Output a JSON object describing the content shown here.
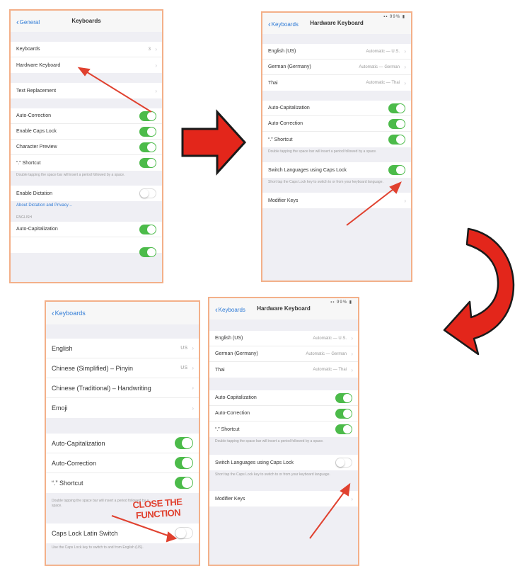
{
  "phones": {
    "p1": {
      "back": "General",
      "title": "Keyboards",
      "rows_a": [
        {
          "label": "Keyboards",
          "value": "3"
        },
        {
          "label": "Hardware Keyboard",
          "value": ""
        }
      ],
      "rows_b": [
        {
          "label": "Text Replacement",
          "value": ""
        }
      ],
      "toggles": [
        {
          "label": "Auto-Correction",
          "on": true
        },
        {
          "label": "Enable Caps Lock",
          "on": true
        },
        {
          "label": "Character Preview",
          "on": true
        },
        {
          "label": "“.” Shortcut",
          "on": true
        }
      ],
      "note_shortcut": "Double tapping the space bar will insert a period followed by a space.",
      "dictation": {
        "label": "Enable Dictation",
        "on": false
      },
      "dictation_link": "About Dictation and Privacy…",
      "section": "ENGLISH",
      "autocap": {
        "label": "Auto-Capitalization",
        "on": true
      }
    },
    "p2": {
      "status": "▪▪ 99% ▮",
      "back": "Keyboards",
      "title": "Hardware Keyboard",
      "langs": [
        {
          "label": "English (US)",
          "value": "Automatic — U.S."
        },
        {
          "label": "German (Germany)",
          "value": "Automatic — German"
        },
        {
          "label": "Thai",
          "value": "Automatic — Thai"
        }
      ],
      "toggles": [
        {
          "label": "Auto-Capitalization",
          "on": true
        },
        {
          "label": "Auto-Correction",
          "on": true
        },
        {
          "label": "“.” Shortcut",
          "on": true
        }
      ],
      "note_shortcut": "Double tapping the space bar will insert a period followed by a space.",
      "switch": {
        "label": "Switch Languages using Caps Lock",
        "on": true
      },
      "note_switch": "Short tap the Caps Lock key to switch to or from your keyboard language.",
      "modifier": "Modifier Keys"
    },
    "p3": {
      "status": "▪▪ 99% ▮",
      "back": "Keyboards",
      "title": "Hardware Keyboard",
      "langs": [
        {
          "label": "English (US)",
          "value": "Automatic — U.S."
        },
        {
          "label": "German (Germany)",
          "value": "Automatic — German"
        },
        {
          "label": "Thai",
          "value": "Automatic — Thai"
        }
      ],
      "toggles": [
        {
          "label": "Auto-Capitalization",
          "on": true
        },
        {
          "label": "Auto-Correction",
          "on": true
        },
        {
          "label": "“.” Shortcut",
          "on": true
        }
      ],
      "note_shortcut": "Double tapping the space bar will insert a period followed by a space.",
      "switch": {
        "label": "Switch Languages using Caps Lock",
        "on": false
      },
      "note_switch": "Short tap the Caps Lock key to switch to or from your keyboard language.",
      "modifier": "Modifier Keys"
    },
    "p4": {
      "back": "Keyboards",
      "langs": [
        {
          "label": "English",
          "value": "US"
        },
        {
          "label": "Chinese (Simplified) – Pinyin",
          "value": "US"
        },
        {
          "label": "Chinese (Traditional) – Handwriting",
          "value": ""
        },
        {
          "label": "Emoji",
          "value": ""
        }
      ],
      "toggles": [
        {
          "label": "Auto-Capitalization",
          "on": true
        },
        {
          "label": "Auto-Correction",
          "on": true
        },
        {
          "label": "“.” Shortcut",
          "on": true
        }
      ],
      "note_shortcut": "Double tapping the space bar will insert a period followed by a space.",
      "capslock": {
        "label": "Caps Lock Latin Switch",
        "on": false
      },
      "note_caps": "Use the Caps Lock key to switch to and from English (US)."
    }
  },
  "annotation": {
    "line1": "CLOSE THE",
    "line2": "FUNCTION"
  },
  "colors": {
    "arrow_red": "#e3261b",
    "annotation_red": "#e0412f",
    "toggle_green": "#4cbb4a",
    "frame_orange": "#f3b089",
    "ios_blue": "#2f7bd6"
  }
}
